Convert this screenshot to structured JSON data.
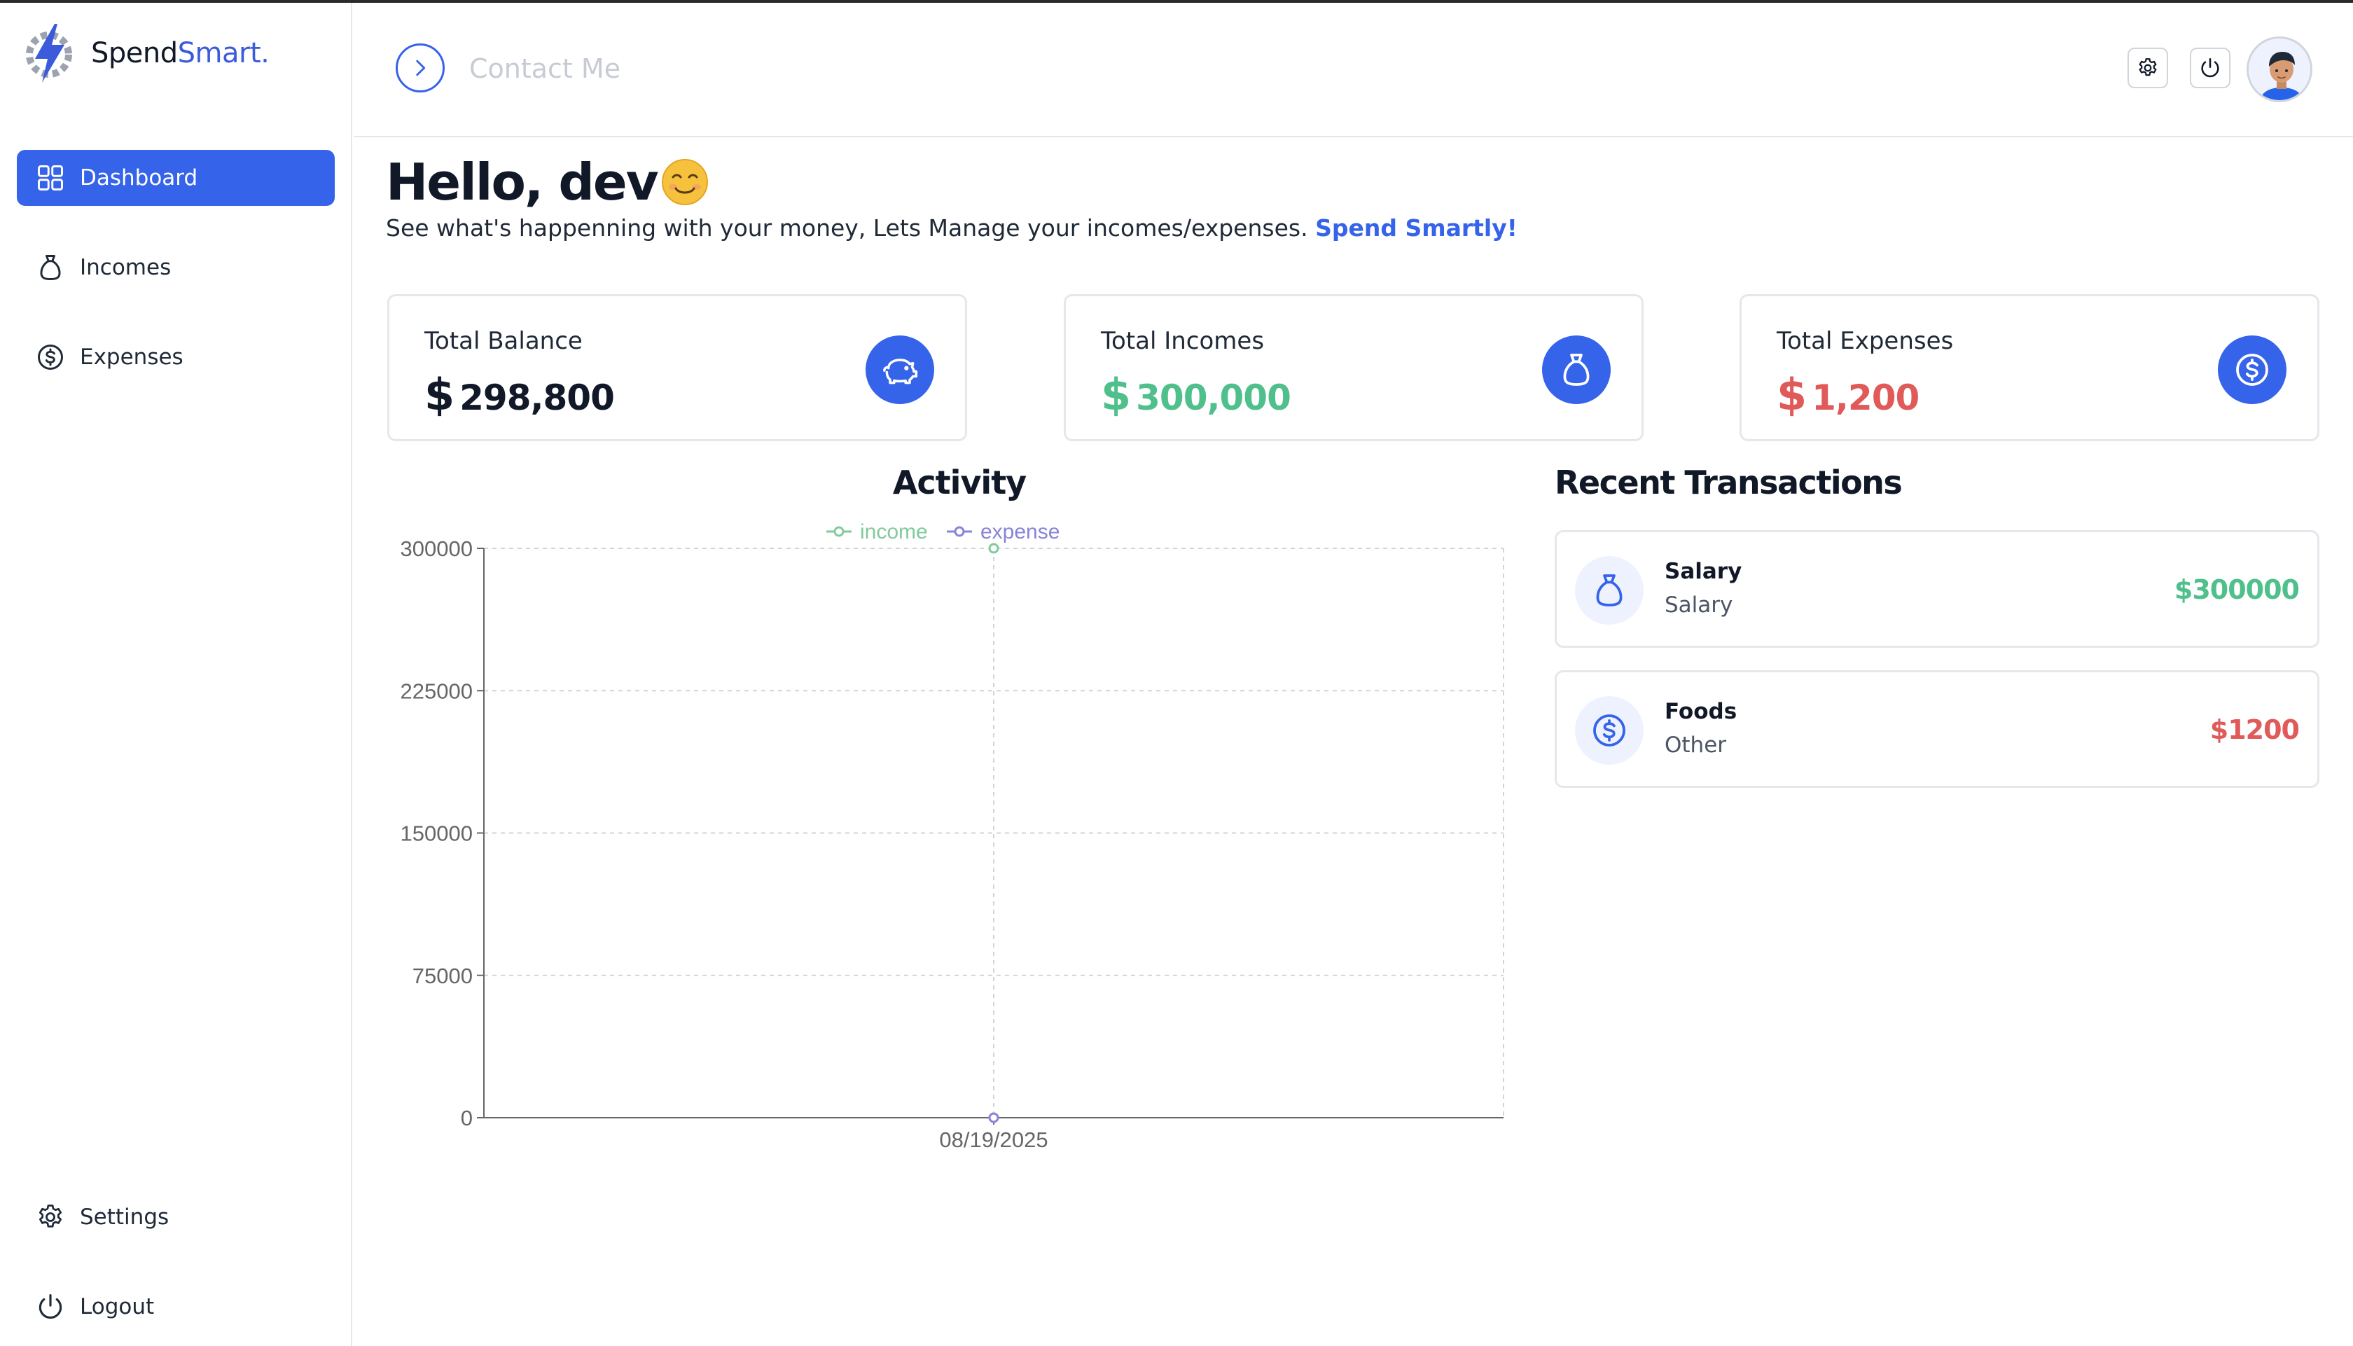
{
  "app": {
    "brand_part1": "Spend",
    "brand_part2": "Smart."
  },
  "sidebar": {
    "items": [
      {
        "label": "Dashboard",
        "icon": "grid-icon",
        "active": true
      },
      {
        "label": "Incomes",
        "icon": "money-bag-icon",
        "active": false
      },
      {
        "label": "Expenses",
        "icon": "dollar-circle-icon",
        "active": false
      }
    ],
    "bottom_items": [
      {
        "label": "Settings",
        "icon": "gear-icon"
      },
      {
        "label": "Logout",
        "icon": "power-icon"
      }
    ]
  },
  "header": {
    "contact_label": "Contact Me"
  },
  "greeting": {
    "hello": "Hello, dev",
    "subtitle": "See what's happenning with your money, Lets Manage your incomes/expenses.",
    "subtitle_link": "Spend Smartly!"
  },
  "summary": [
    {
      "label": "Total Balance",
      "currency": "$",
      "value": "298,800",
      "color": "#111827",
      "icon": "piggy-bank-icon"
    },
    {
      "label": "Total Incomes",
      "currency": "$",
      "value": "300,000",
      "color": "#4fbf8c",
      "icon": "money-bag-icon"
    },
    {
      "label": "Total Expenses",
      "currency": "$",
      "value": "1,200",
      "color": "#e05a5a",
      "icon": "dollar-circle-icon"
    }
  ],
  "activity": {
    "title": "Activity"
  },
  "chart_data": {
    "type": "line",
    "title": "Activity",
    "x": [
      "08/19/2025"
    ],
    "series": [
      {
        "name": "income",
        "values": [
          300000
        ],
        "color": "#82ca9d"
      },
      {
        "name": "expense",
        "values": [
          0
        ],
        "color": "#8884d8"
      }
    ],
    "ylim": [
      0,
      300000
    ],
    "yticks": [
      0,
      75000,
      150000,
      225000,
      300000
    ],
    "grid": true,
    "legend": "top-center",
    "xlabel": "",
    "ylabel": ""
  },
  "recent": {
    "title": "Recent Transactions",
    "items": [
      {
        "name": "Salary",
        "category": "Salary",
        "amount": "$300000",
        "color": "#4fbf8c",
        "icon": "money-bag-icon"
      },
      {
        "name": "Foods",
        "category": "Other",
        "amount": "$1200",
        "color": "#e05a5a",
        "icon": "dollar-circle-icon"
      }
    ]
  },
  "colors": {
    "accent": "#3563e9",
    "income": "#4fbf8c",
    "expense": "#e05a5a"
  }
}
